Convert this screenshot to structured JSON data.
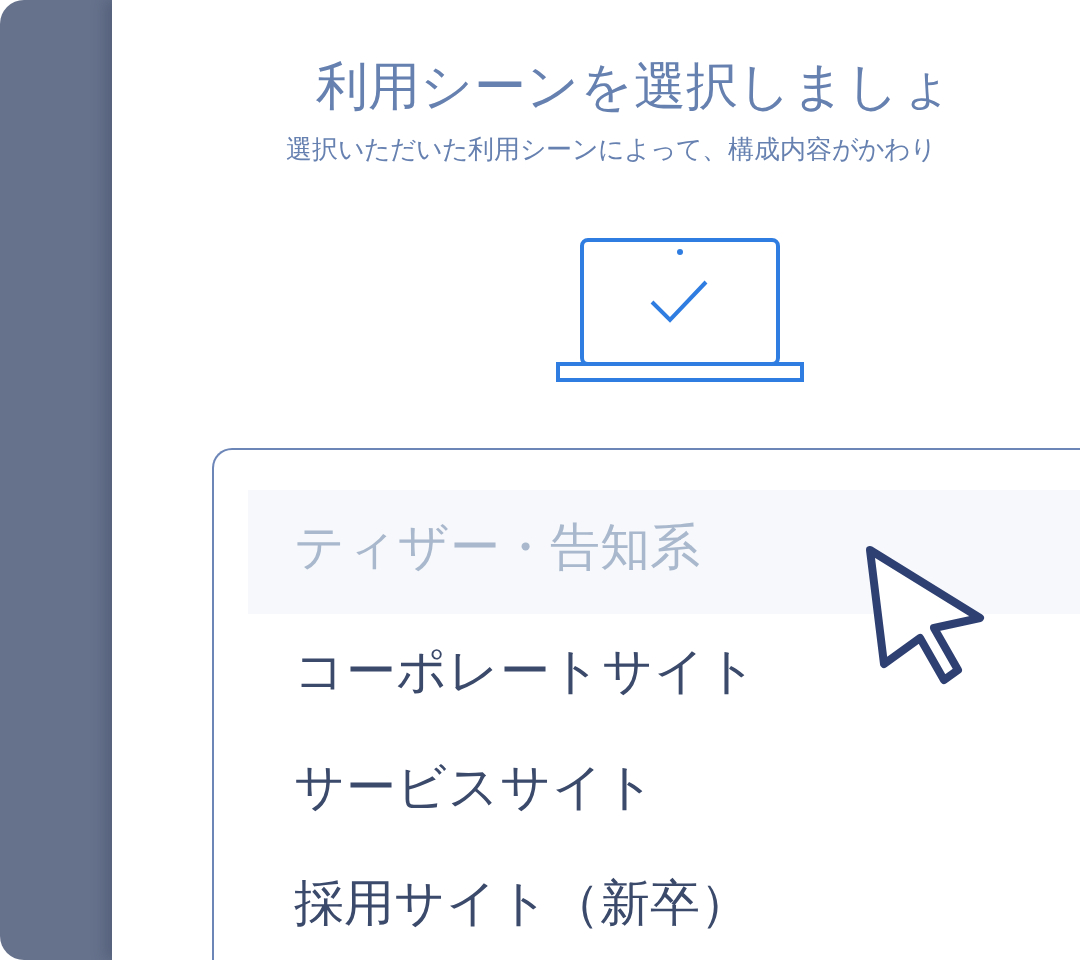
{
  "title": "利用シーンを選択しましょ",
  "subtitle": "選択いただいた利用シーンによって、構成内容がかわり",
  "options": [
    {
      "label": "ティザー・告知系",
      "selected": true
    },
    {
      "label": "コーポレートサイト",
      "selected": false
    },
    {
      "label": "サービスサイト",
      "selected": false
    },
    {
      "label": "採用サイト（新卒）",
      "selected": false
    }
  ]
}
